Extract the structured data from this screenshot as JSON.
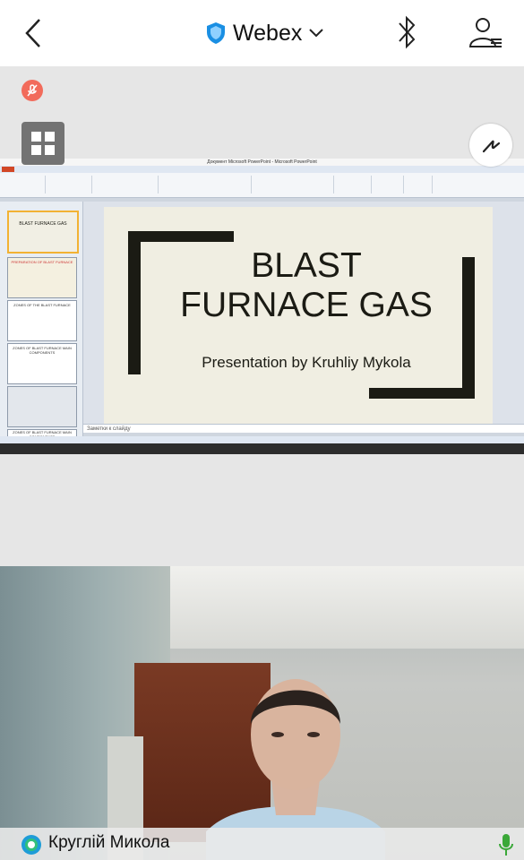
{
  "header": {
    "brand": "Webex"
  },
  "shared_screen": {
    "window_title": "Документ Microsoft PowerPoint - Microsoft PowerPoint",
    "slide": {
      "title_line1": "BLAST",
      "title_line2": "FURNACE GAS",
      "subtitle": "Presentation by Kruhliy Mykola"
    },
    "thumbnails": [
      {
        "text": "BLAST FURNACE GAS"
      },
      {
        "text": "PREPARATION OF BLAST FURNACE"
      },
      {
        "text": "ZONES OF THE BLAST FURNACE"
      },
      {
        "text": "ZONES OF BLAST FURNACE MAIN COMPONENTS"
      },
      {
        "text": ""
      },
      {
        "text": "ZONES OF BLAST FURNACE MAIN COMPONENTS"
      }
    ],
    "notes_text": "Заметки к слайду"
  },
  "participant": {
    "name": "Круглій Микола"
  },
  "colors": {
    "mute": "#f26b5b",
    "mic_active": "#3aa838",
    "accent": "#1b1b14"
  }
}
